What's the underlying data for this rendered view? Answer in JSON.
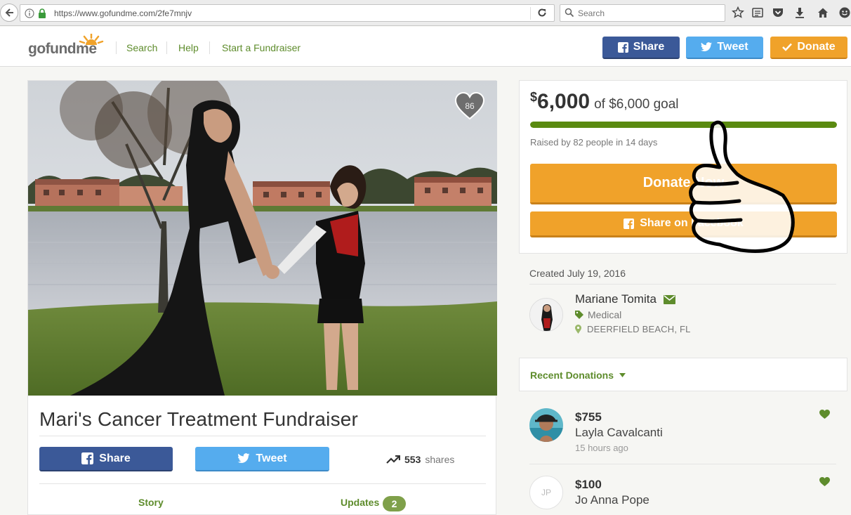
{
  "browser": {
    "url": "https://www.gofundme.com/2fe7mnjv",
    "search_placeholder": "Search"
  },
  "header": {
    "logo_text_go": "gofund",
    "logo_text_me": "me",
    "nav": [
      "Search",
      "Help",
      "Start a Fundraiser"
    ],
    "share_label": "Share",
    "tweet_label": "Tweet",
    "donate_label": "Donate"
  },
  "campaign": {
    "hearts": "86",
    "title": "Mari's Cancer Treatment Fundraiser",
    "share_label": "Share",
    "tweet_label": "Tweet",
    "shares_count": "553",
    "shares_label": "shares",
    "tab_story": "Story",
    "tab_updates": "Updates",
    "updates_count": "2"
  },
  "goal": {
    "currency": "$",
    "raised": "6,000",
    "goal_text": "of $6,000 goal",
    "progress_fraction": 1.0,
    "raised_by": "Raised by 82 people in 14 days",
    "donate_now": "Donate Now",
    "share_facebook": "Share on Facebook"
  },
  "organizer": {
    "created": "Created July 19, 2016",
    "name": "Mariane Tomita",
    "category": "Medical",
    "location": "DEERFIELD BEACH, FL"
  },
  "donations": {
    "title": "Recent Donations",
    "items": [
      {
        "amount": "$755",
        "name": "Layla Cavalcanti",
        "time": "15 hours ago",
        "initials": ""
      },
      {
        "amount": "$100",
        "name": "Jo Anna Pope",
        "time": "",
        "initials": "JP"
      }
    ]
  },
  "colors": {
    "green": "#5e8c2c",
    "facebook": "#3b5998",
    "twitter": "#55acee",
    "orange": "#f0a22a"
  }
}
